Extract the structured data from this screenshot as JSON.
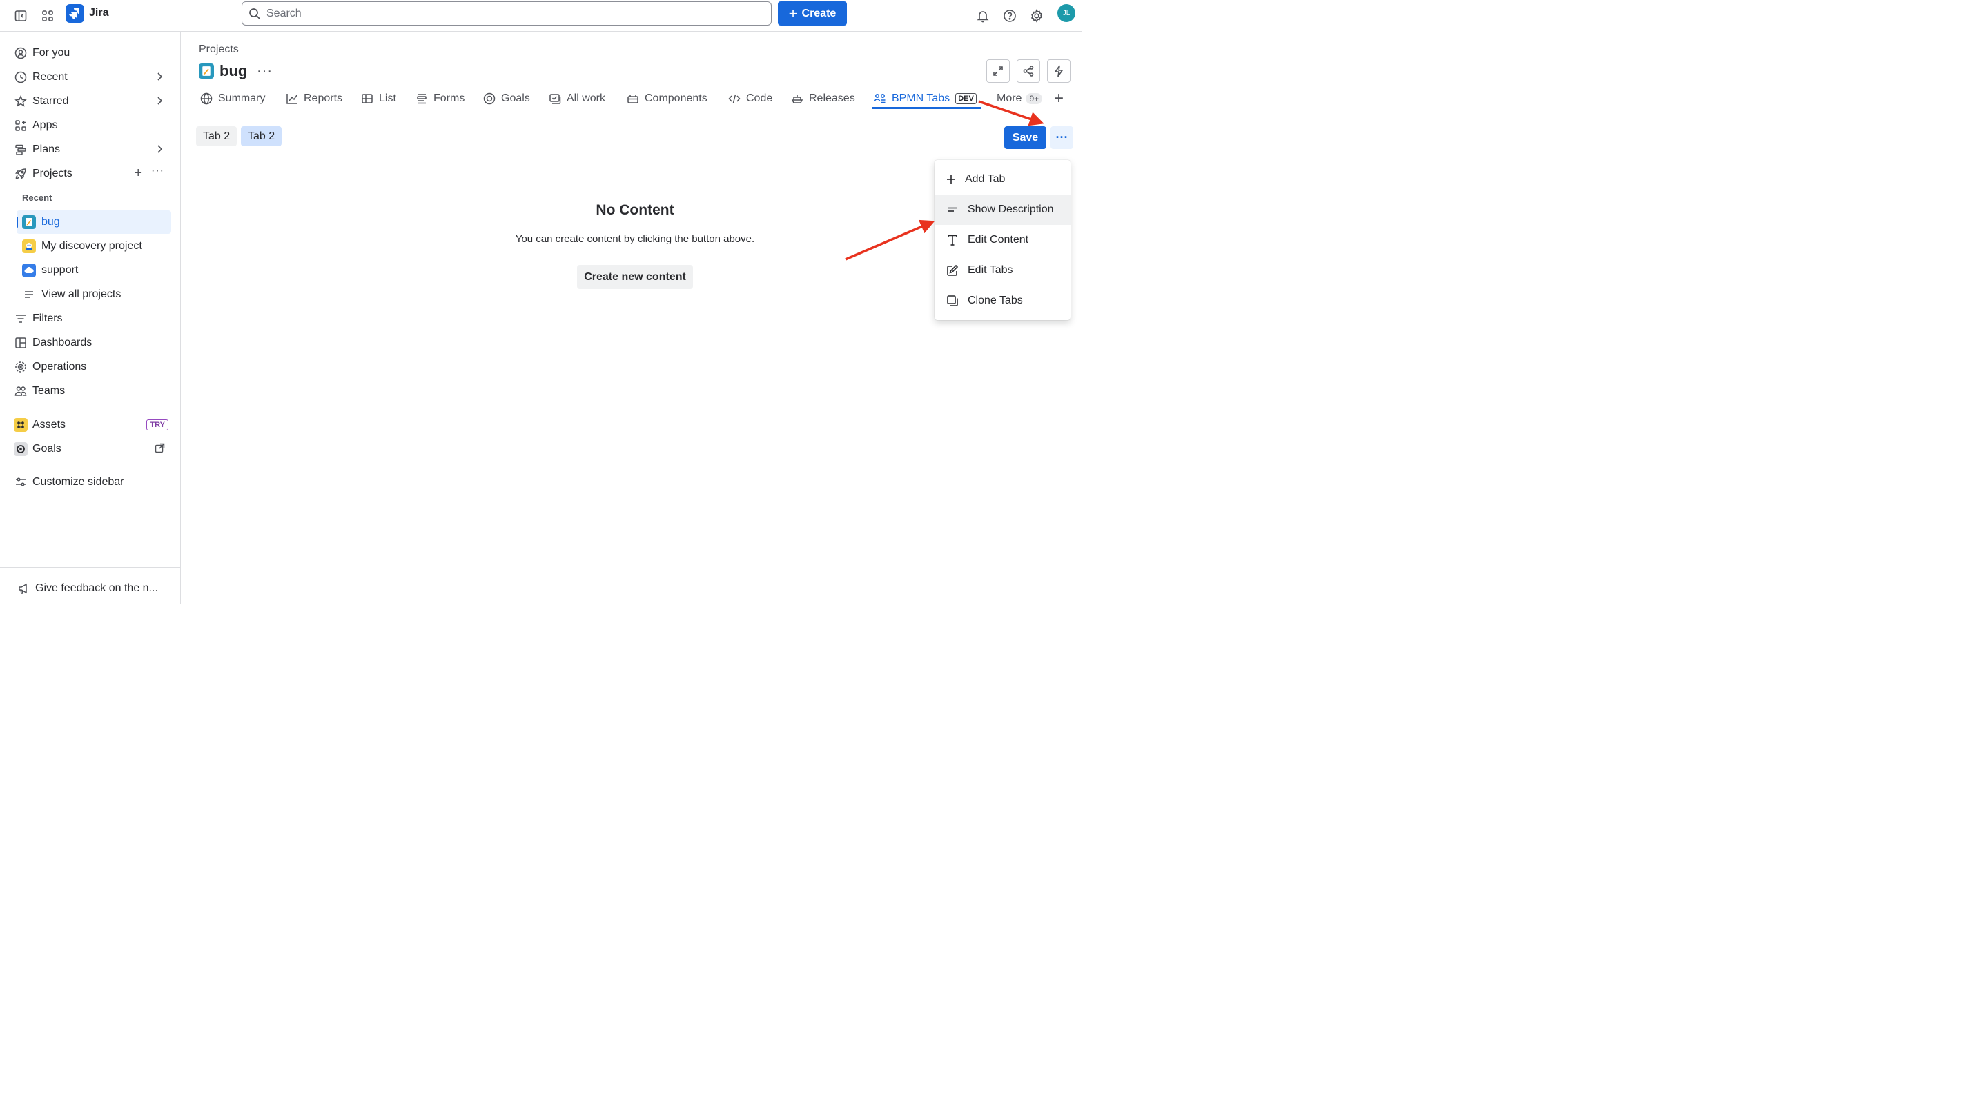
{
  "topbar": {
    "app_name": "Jira",
    "search_placeholder": "Search",
    "create_label": "Create",
    "avatar_initials": "JL"
  },
  "sidebar": {
    "items": [
      {
        "label": "For you",
        "icon": "user-circle-icon"
      },
      {
        "label": "Recent",
        "icon": "clock-icon"
      },
      {
        "label": "Starred",
        "icon": "star-icon"
      },
      {
        "label": "Apps",
        "icon": "apps-icon"
      },
      {
        "label": "Plans",
        "icon": "plans-icon"
      },
      {
        "label": "Projects",
        "icon": "rocket-icon"
      }
    ],
    "recent_label": "Recent",
    "projects": [
      {
        "label": "bug",
        "active": true
      },
      {
        "label": "My discovery project"
      },
      {
        "label": "support"
      }
    ],
    "view_all_projects": "View all projects",
    "items2": [
      {
        "label": "Filters",
        "icon": "filter-icon"
      },
      {
        "label": "Dashboards",
        "icon": "dashboard-icon"
      },
      {
        "label": "Operations",
        "icon": "operations-icon"
      },
      {
        "label": "Teams",
        "icon": "teams-icon"
      }
    ],
    "assets_label": "Assets",
    "assets_badge": "TRY",
    "goals_label": "Goals",
    "customize_label": "Customize sidebar",
    "feedback_label": "Give feedback on the n..."
  },
  "page": {
    "breadcrumb": "Projects",
    "project_title": "bug"
  },
  "tabs": [
    {
      "label": "Summary",
      "icon": "globe-icon"
    },
    {
      "label": "Reports",
      "icon": "chart-line-icon"
    },
    {
      "label": "List",
      "icon": "list-icon"
    },
    {
      "label": "Forms",
      "icon": "forms-icon"
    },
    {
      "label": "Goals",
      "icon": "goal-icon"
    },
    {
      "label": "All work",
      "icon": "all-work-icon"
    },
    {
      "label": "Components",
      "icon": "component-icon"
    },
    {
      "label": "Code",
      "icon": "code-icon"
    },
    {
      "label": "Releases",
      "icon": "ship-icon"
    },
    {
      "label": "BPMN Tabs",
      "icon": "bpmn-icon",
      "badge": "DEV",
      "active": true
    },
    {
      "label": "More",
      "badge": "9+"
    }
  ],
  "content_tabs": [
    "Tab 2",
    "Tab 2"
  ],
  "save_label": "Save",
  "empty_state": {
    "title": "No Content",
    "description": "You can create content by clicking the button above.",
    "button": "Create new content"
  },
  "menu": [
    {
      "label": "Add Tab",
      "icon": "plus-icon"
    },
    {
      "label": "Show Description",
      "icon": "description-icon",
      "hover": true
    },
    {
      "label": "Edit Content",
      "icon": "text-icon"
    },
    {
      "label": "Edit Tabs",
      "icon": "edit-icon"
    },
    {
      "label": "Clone Tabs",
      "icon": "clone-icon"
    }
  ],
  "colors": {
    "brand": "#1868db",
    "annotation_arrow": "#e8321e",
    "selected_chip": "#cfe1fd"
  }
}
